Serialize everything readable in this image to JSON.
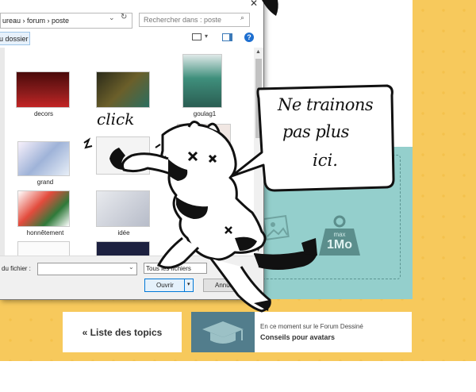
{
  "dialog": {
    "address_text": "ureau › forum › poste",
    "search_placeholder": "Rechercher dans : poste",
    "new_folder_label": "u dossier",
    "files": [
      {
        "name": "decors"
      },
      {
        "name": ""
      },
      {
        "name": "goulag1"
      },
      {
        "name": ""
      },
      {
        "name": ""
      },
      {
        "name": ""
      },
      {
        "name": "grand"
      },
      {
        "name": ""
      },
      {
        "name": ""
      },
      {
        "name": "honnêtement"
      },
      {
        "name": "idée"
      },
      {
        "name": ""
      }
    ],
    "filename_label": "du fichier :",
    "filename_value": "",
    "filetype_value": "Tous les fichiers",
    "open_label": "Ouvrir",
    "cancel_label": "Annuler"
  },
  "comic": {
    "bubble_line1": "Ne trainons",
    "bubble_line2": "pas plus",
    "bubble_line3": "ici.",
    "click_text": "click"
  },
  "upload": {
    "max_label": "max",
    "max_value": "1Mo"
  },
  "footer": {
    "topics_button": "« Liste des topics",
    "forum_line1": "En ce moment sur le Forum Dessiné",
    "forum_line2": "Conseils pour avatars"
  }
}
